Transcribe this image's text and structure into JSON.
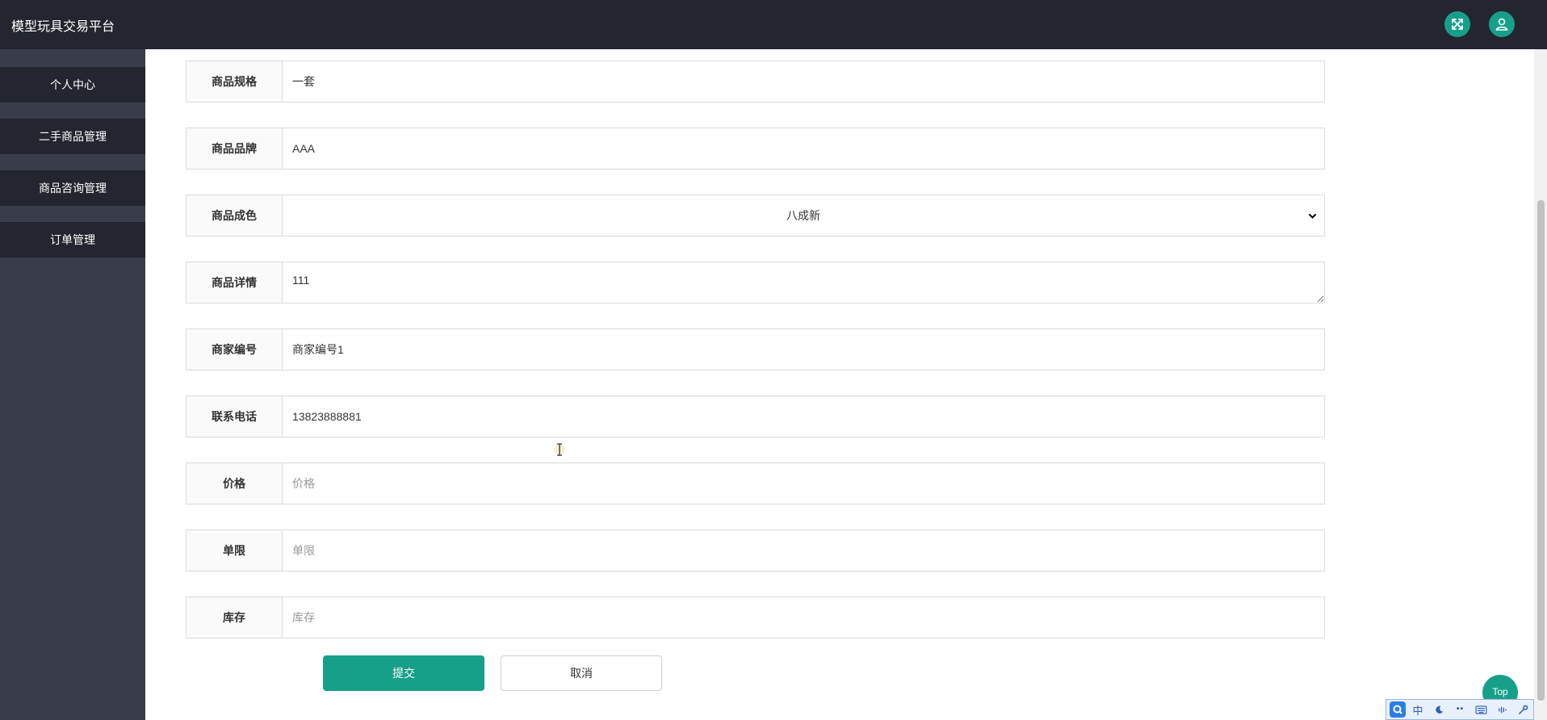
{
  "app": {
    "title": "模型玩具交易平台"
  },
  "header": {
    "icons": [
      "expand-icon",
      "user-icon"
    ]
  },
  "sidebar": {
    "items": [
      {
        "label": "个人中心"
      },
      {
        "label": "二手商品管理"
      },
      {
        "label": "商品咨询管理"
      },
      {
        "label": "订单管理"
      }
    ]
  },
  "form": {
    "spec": {
      "label": "商品规格",
      "value": "一套"
    },
    "brand": {
      "label": "商品品牌",
      "value": "AAA"
    },
    "condition": {
      "label": "商品成色",
      "selected": "八成新"
    },
    "detail": {
      "label": "商品详情",
      "value": "111"
    },
    "merchant_no": {
      "label": "商家编号",
      "value": "商家编号1"
    },
    "phone": {
      "label": "联系电话",
      "value": "13823888881"
    },
    "price": {
      "label": "价格",
      "placeholder": "价格"
    },
    "limit": {
      "label": "单限",
      "placeholder": "单限"
    },
    "stock": {
      "label": "库存",
      "placeholder": "库存"
    },
    "submit_label": "提交",
    "cancel_label": "取消"
  },
  "top_button": {
    "label": "Top"
  },
  "ime": {
    "mode": "中"
  },
  "colors": {
    "header": "#23262e",
    "sidebar": "#393d49",
    "accent": "#16a08a"
  }
}
